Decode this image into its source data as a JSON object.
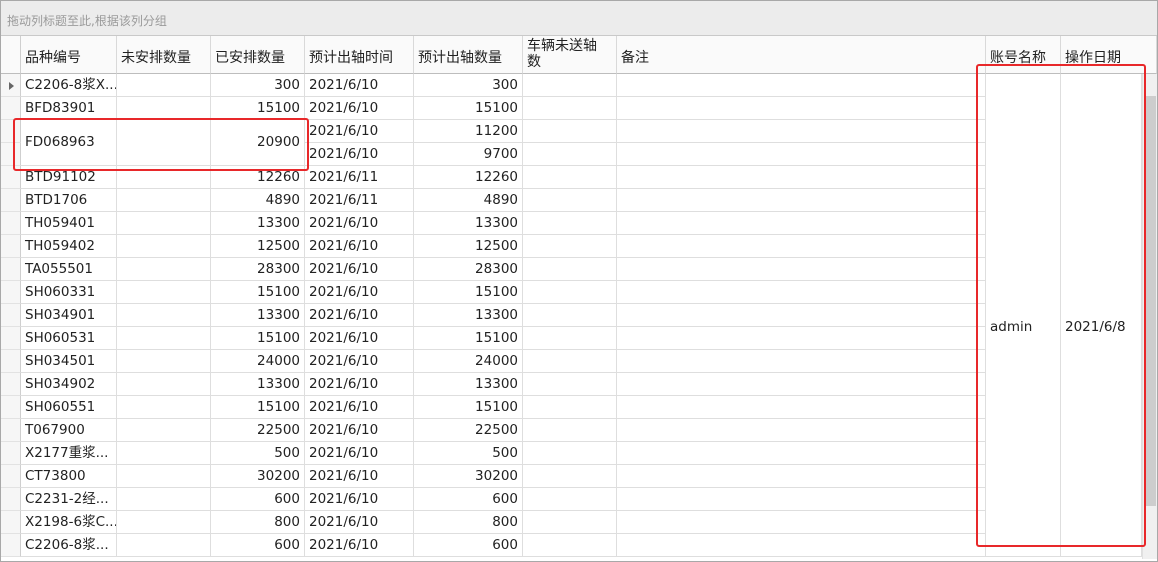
{
  "group_panel": {
    "hint": "拖动列标题至此,根据该列分组"
  },
  "columns": [
    "品种编号",
    "未安排数量",
    "已安排数量",
    "预计出轴时间",
    "预计出轴数量",
    "车辆未送轴数",
    "备注",
    "账号名称",
    "操作日期"
  ],
  "rows": [
    {
      "code": "C2206-8浆X...",
      "unarranged": "",
      "arranged": "300",
      "time": "2021/6/10",
      "qty": "300",
      "unsent": "",
      "note": ""
    },
    {
      "code": "BFD83901",
      "unarranged": "",
      "arranged": "15100",
      "time": "2021/6/10",
      "qty": "15100",
      "unsent": "",
      "note": ""
    },
    {
      "code": "FD068963",
      "unarranged": "",
      "arranged": "20900",
      "time": "2021/6/10",
      "qty": "11200",
      "unsent": "",
      "note": ""
    },
    {
      "code": "",
      "unarranged": "",
      "arranged": "",
      "time": "2021/6/10",
      "qty": "9700",
      "unsent": "",
      "note": ""
    },
    {
      "code": "BTD91102",
      "unarranged": "",
      "arranged": "12260",
      "time": "2021/6/11",
      "qty": "12260",
      "unsent": "",
      "note": ""
    },
    {
      "code": "BTD1706",
      "unarranged": "",
      "arranged": "4890",
      "time": "2021/6/11",
      "qty": "4890",
      "unsent": "",
      "note": ""
    },
    {
      "code": "TH059401",
      "unarranged": "",
      "arranged": "13300",
      "time": "2021/6/10",
      "qty": "13300",
      "unsent": "",
      "note": ""
    },
    {
      "code": "TH059402",
      "unarranged": "",
      "arranged": "12500",
      "time": "2021/6/10",
      "qty": "12500",
      "unsent": "",
      "note": ""
    },
    {
      "code": "TA055501",
      "unarranged": "",
      "arranged": "28300",
      "time": "2021/6/10",
      "qty": "28300",
      "unsent": "",
      "note": ""
    },
    {
      "code": "SH060331",
      "unarranged": "",
      "arranged": "15100",
      "time": "2021/6/10",
      "qty": "15100",
      "unsent": "",
      "note": ""
    },
    {
      "code": "SH034901",
      "unarranged": "",
      "arranged": "13300",
      "time": "2021/6/10",
      "qty": "13300",
      "unsent": "",
      "note": ""
    },
    {
      "code": "SH060531",
      "unarranged": "",
      "arranged": "15100",
      "time": "2021/6/10",
      "qty": "15100",
      "unsent": "",
      "note": ""
    },
    {
      "code": "SH034501",
      "unarranged": "",
      "arranged": "24000",
      "time": "2021/6/10",
      "qty": "24000",
      "unsent": "",
      "note": ""
    },
    {
      "code": "SH034902",
      "unarranged": "",
      "arranged": "13300",
      "time": "2021/6/10",
      "qty": "13300",
      "unsent": "",
      "note": ""
    },
    {
      "code": "SH060551",
      "unarranged": "",
      "arranged": "15100",
      "time": "2021/6/10",
      "qty": "15100",
      "unsent": "",
      "note": ""
    },
    {
      "code": "T067900",
      "unarranged": "",
      "arranged": "22500",
      "time": "2021/6/10",
      "qty": "22500",
      "unsent": "",
      "note": ""
    },
    {
      "code": "X2177重浆...",
      "unarranged": "",
      "arranged": "500",
      "time": "2021/6/10",
      "qty": "500",
      "unsent": "",
      "note": ""
    },
    {
      "code": "CT73800",
      "unarranged": "",
      "arranged": "30200",
      "time": "2021/6/10",
      "qty": "30200",
      "unsent": "",
      "note": ""
    },
    {
      "code": "C2231-2经...",
      "unarranged": "",
      "arranged": "600",
      "time": "2021/6/10",
      "qty": "600",
      "unsent": "",
      "note": ""
    },
    {
      "code": "X2198-6浆C...",
      "unarranged": "",
      "arranged": "800",
      "time": "2021/6/10",
      "qty": "800",
      "unsent": "",
      "note": ""
    },
    {
      "code": "C2206-8浆...",
      "unarranged": "",
      "arranged": "600",
      "time": "2021/6/10",
      "qty": "600",
      "unsent": "",
      "note": ""
    }
  ],
  "merged": {
    "account": "admin",
    "op_date": "2021/6/8"
  },
  "colors": {
    "highlight": "#e8282a"
  }
}
